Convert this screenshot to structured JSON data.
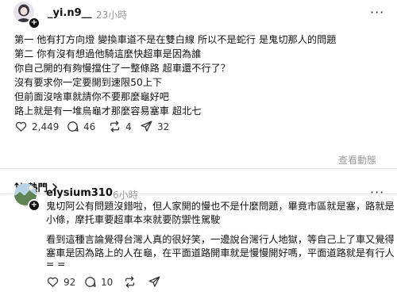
{
  "post": {
    "username": "_yi.n9__",
    "time": "23小時",
    "lines": [
      "第一 他有打方向燈 變換車道不是在雙白線 所以不是蛇行 是鬼切那人的問題",
      "第二 你有沒有想過他騎這麼快超車是因為誰",
      "你自己開的有夠慢擋住了一整條路 超車還不行了？",
      "沒有要求你一定要開到速限50上下",
      "但前面沒啥車就請你不要那麼龜好吧",
      "路上就是有一堆烏龜才那麼容易塞車 超北七"
    ],
    "likes": "2,449",
    "comments": "46",
    "reposts": "4",
    "shares": "32",
    "view_activity": "查看動態"
  },
  "sort": {
    "label": "熱門"
  },
  "reply": {
    "username": "elysium310",
    "time": "6小時",
    "para1": [
      "鬼切阿公有問題沒錯啦，但人家開的慢也不是什麼問題，畢竟市區就是塞，路就是",
      "小條，摩托車要超車本來就要防禦性駕駛"
    ],
    "para2": [
      "看到這種言論覺得台灣人真的很好笑，一邊說台灣行人地獄，等自己上了車又覺得",
      "塞車是因為路上的人在龜，在平面道路開車就是慢慢開好嗎，平面道路就是有行人",
      "= ="
    ],
    "likes": "92",
    "comments": "10"
  },
  "colors": {
    "text": "#101010",
    "muted": "#9a9a9a",
    "divider": "#e6e6e6"
  }
}
